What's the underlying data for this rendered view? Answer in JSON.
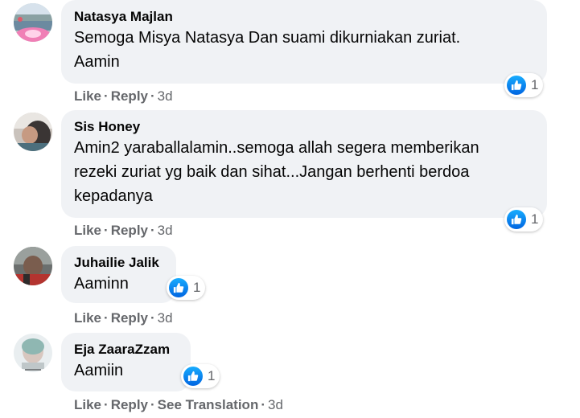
{
  "comments": [
    {
      "author": "Natasya Majlan",
      "text": "Semoga Misya Natasya Dan suami dikurniakan zuriat.\nAamin",
      "reaction_count": "1",
      "actions": [
        "Like",
        "Reply"
      ],
      "time": "3d"
    },
    {
      "author": "Sis Honey",
      "text": "Amin2 yaraballalamin..semoga allah segera memberikan\nrezeki zuriat yg baik dan sihat...Jangan berhenti berdoa\nkepadanya",
      "reaction_count": "1",
      "actions": [
        "Like",
        "Reply"
      ],
      "time": "3d"
    },
    {
      "author": "Juhailie Jalik",
      "text": "Aaminn",
      "reaction_count": "1",
      "actions": [
        "Like",
        "Reply"
      ],
      "time": "3d"
    },
    {
      "author": "Eja ZaaraZzam",
      "text": "Aamiin",
      "reaction_count": "1",
      "actions": [
        "Like",
        "Reply",
        "See Translation"
      ],
      "time": "3d"
    }
  ],
  "separator": "·",
  "colors": {
    "bubble": "#f0f2f5",
    "secondary_text": "#65676b",
    "like_blue": "#1877f2"
  }
}
